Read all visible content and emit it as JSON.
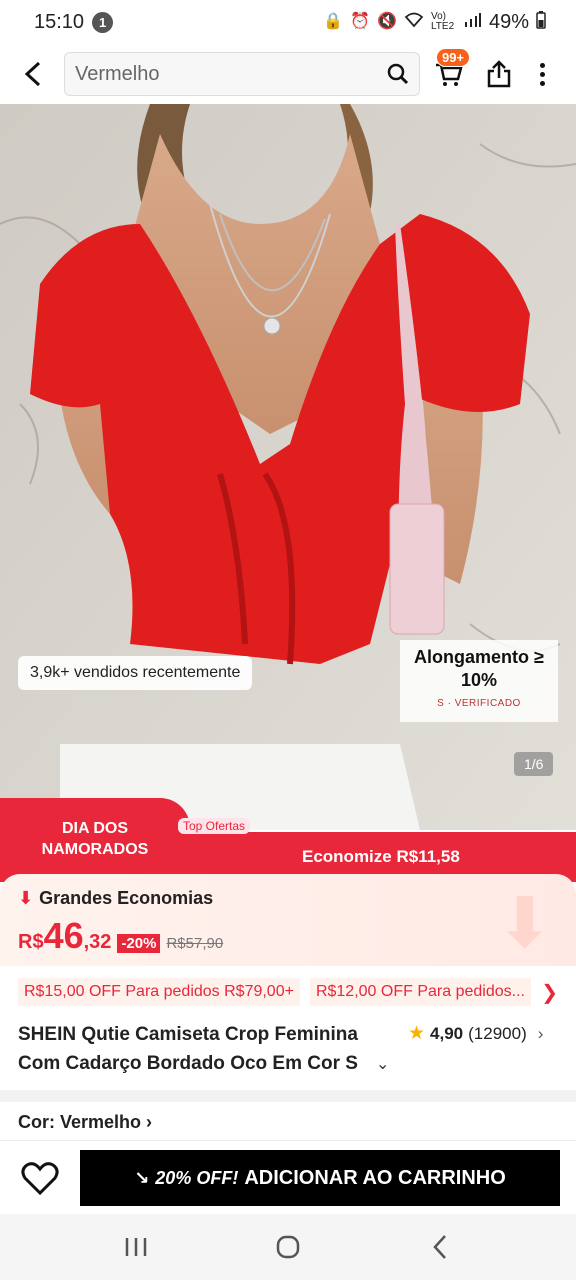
{
  "status_bar": {
    "time": "15:10",
    "notification_count": "1",
    "network": "Vo) LTE2",
    "battery": "49%"
  },
  "top_bar": {
    "search_value": "Vermelho",
    "cart_badge": "99+"
  },
  "product_image": {
    "sold_badge": "3,9k+ vendidos recentemente",
    "stretch_title": "Alongamento ≥ 10%",
    "stretch_sub": "S · VERIFICADO",
    "page_indicator": "1/6"
  },
  "promo": {
    "event_line1": "DIA DOS",
    "event_line2": "NAMORADOS",
    "tag": "Top Ofertas",
    "savings": "Economize R$11,58"
  },
  "price": {
    "label": "Grandes Economias",
    "currency": "R$",
    "integer": "46",
    "decimal": ",32",
    "discount": "-20%",
    "old_price": "R$57,90"
  },
  "coupons": [
    "R$15,00 OFF Para pedidos R$79,00+",
    "R$12,00 OFF Para pedidos..."
  ],
  "product": {
    "title": "SHEIN Qutie Camiseta Crop Feminina Com Cadarço Bordado Oco Em Cor S",
    "rating": "4,90",
    "reviews": "(12900)"
  },
  "color": {
    "label": "Cor: Vermelho"
  },
  "action": {
    "off_label": "20% OFF!",
    "add_label": "ADICIONAR AO CARRINHO"
  },
  "colors": {
    "accent": "#e8273a",
    "orange": "#f9601a",
    "star": "#f5b400"
  }
}
